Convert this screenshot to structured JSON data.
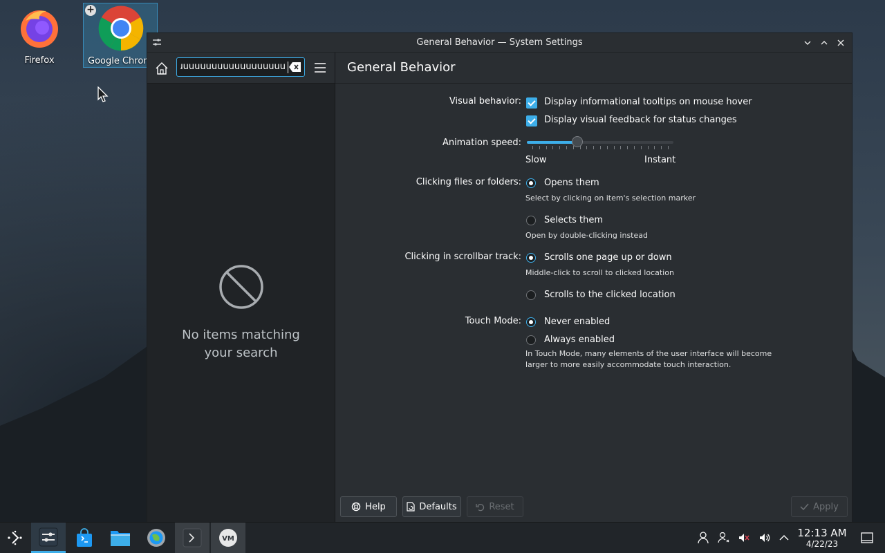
{
  "desktop": {
    "icons": [
      {
        "label": "Firefox"
      },
      {
        "label": "Google Chrome"
      }
    ]
  },
  "window": {
    "title": "General Behavior — System Settings",
    "search": {
      "value": "uuuuuuuuuuuuuuuuuuuu"
    },
    "empty_message_line1": "No items matching",
    "empty_message_line2": "your search",
    "page_title": "General Behavior"
  },
  "settings": {
    "visual_behavior": {
      "label": "Visual behavior:",
      "opt1": "Display informational tooltips on mouse hover",
      "opt2": "Display visual feedback for status changes"
    },
    "animation_speed": {
      "label": "Animation speed:",
      "min_label": "Slow",
      "max_label": "Instant",
      "value_fraction": 0.33
    },
    "clicking_files": {
      "label": "Clicking files or folders:",
      "opt1": "Opens them",
      "opt1_hint": "Select by clicking on item's selection marker",
      "opt2": "Selects them",
      "opt2_hint": "Open by double-clicking instead"
    },
    "scrollbar_track": {
      "label": "Clicking in scrollbar track:",
      "opt1": "Scrolls one page up or down",
      "opt1_hint": "Middle-click to scroll to clicked location",
      "opt2": "Scrolls to the clicked location"
    },
    "touch_mode": {
      "label": "Touch Mode:",
      "opt1": "Never enabled",
      "opt2": "Always enabled",
      "hint": "In Touch Mode, many elements of the user interface will become larger to more easily accommodate touch interaction."
    }
  },
  "footer": {
    "help": "Help",
    "defaults": "Defaults",
    "reset": "Reset",
    "apply": "Apply"
  },
  "taskbar": {
    "time": "12:13 AM",
    "date": "4/22/23"
  },
  "colors": {
    "accent": "#3daee9",
    "window_bg": "#2a2e32",
    "sidebar_bg": "#202326"
  }
}
